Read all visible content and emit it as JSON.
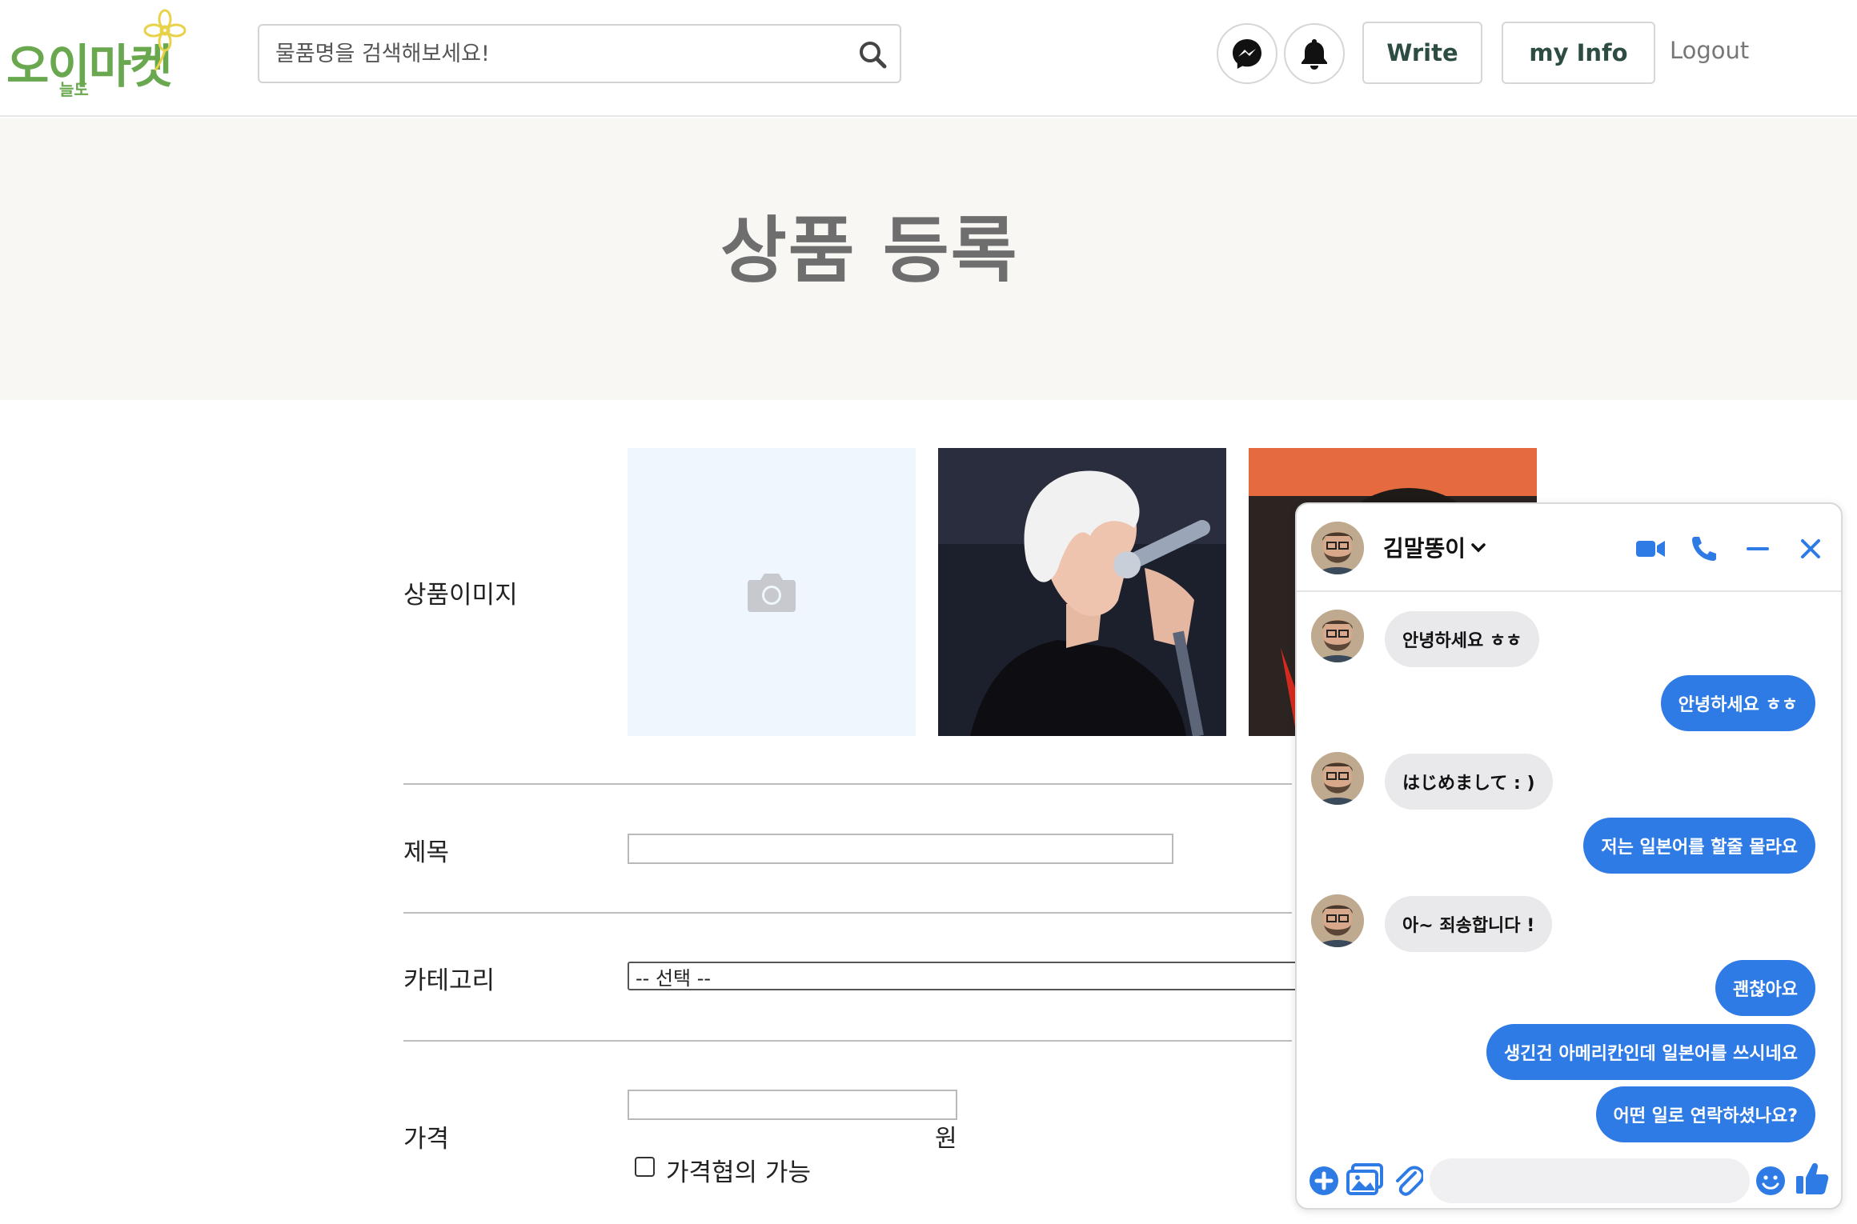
{
  "header": {
    "logo_main": "오이마켓",
    "logo_sub": "늘도",
    "search_placeholder": "물품명을 검색해보세요!",
    "write_label": "Write",
    "myinfo_label": "my Info",
    "logout_label": "Logout"
  },
  "banner": {
    "title": "상품 등록"
  },
  "form": {
    "image_label": "상품이미지",
    "title_label": "제목",
    "category_label": "카테고리",
    "category_selected": "-- 선택 --",
    "price_label": "가격",
    "price_unit": "원",
    "negotiable_label": "가격협의 가능"
  },
  "chat": {
    "contact_name": "김말똥이",
    "messages": [
      {
        "dir": "in",
        "text": "안녕하세요 ㅎㅎ"
      },
      {
        "dir": "out",
        "text": "안녕하세요 ㅎㅎ"
      },
      {
        "dir": "in",
        "text": "はじめまして : )"
      },
      {
        "dir": "out",
        "text": "저는 일본어를 할줄 몰라요"
      },
      {
        "dir": "in",
        "text": "아~ 죄송합니다 !"
      },
      {
        "dir": "out",
        "text": "괜찮아요"
      },
      {
        "dir": "out",
        "text": "생긴건 아메리칸인데 일본어를 쓰시네요"
      },
      {
        "dir": "out",
        "text": "어떤 일로 연락하셨나요?"
      }
    ]
  },
  "colors": {
    "brand_green": "#6aa84f",
    "messenger_blue": "#2e7be6",
    "banner_bg": "#f9f7f3"
  }
}
